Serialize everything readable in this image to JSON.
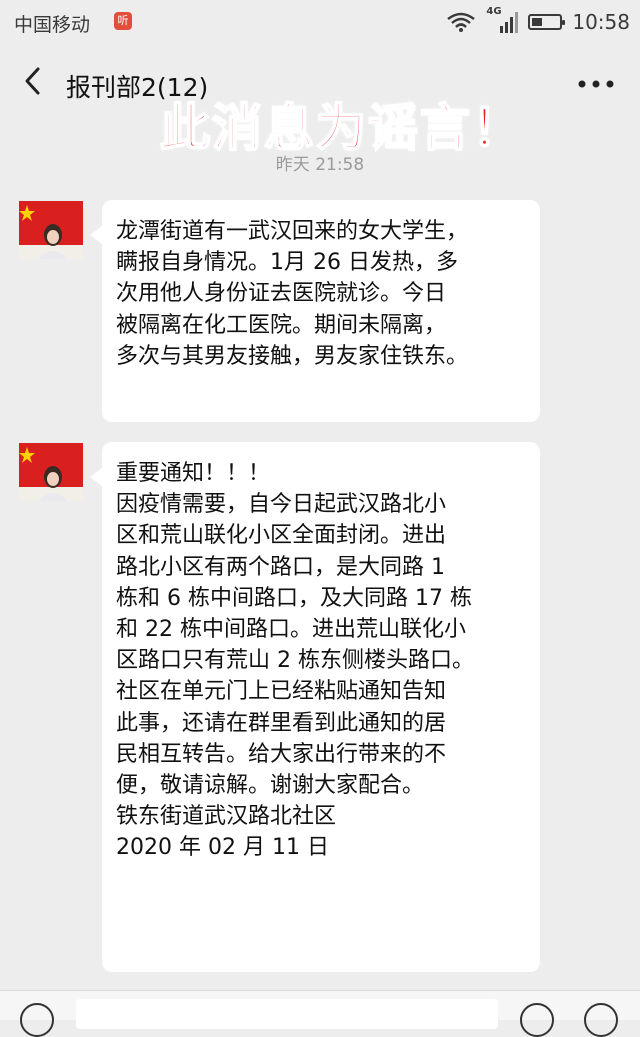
{
  "status_bar": {
    "carrier": "中国移动",
    "notification_badge": "听",
    "network_label": "4G",
    "time": "10:58"
  },
  "chat": {
    "title": "报刊部2(12)"
  },
  "overlay": {
    "rumor_label": "此消息为谣言！"
  },
  "timestamp": "昨天 21:58",
  "messages": [
    {
      "lines": [
        "龙潭街道有一武汉回来的女大学生，",
        "瞒报自身情况。1月 26 日发热，多",
        "次用他人身份证去医院就诊。今日",
        "被隔离在化工医院。期间未隔离，",
        "多次与其男友接触，男友家住铁东。"
      ]
    },
    {
      "lines": [
        "重要通知！！！",
        "因疫情需要，自今日起武汉路北小",
        "区和荒山联化小区全面封闭。进出",
        "路北小区有两个路口，是大同路 1",
        "栋和 6 栋中间路口，及大同路 17 栋",
        "和 22 栋中间路口。进出荒山联化小",
        "区路口只有荒山 2 栋东侧楼头路口。",
        "社区在单元门上已经粘贴通知告知",
        "此事，还请在群里看到此通知的居",
        "民相互转告。给大家出行带来的不",
        "便，敬请谅解。谢谢大家配合。",
        "铁东街道武汉路北社区",
        "2020 年 02 月 11 日"
      ]
    }
  ],
  "colors": {
    "background": "#ededed",
    "bubble": "#ffffff",
    "rumor_red": "#e8202a",
    "timestamp_gray": "#9a9a9a"
  },
  "icons": {
    "back": "back-arrow-icon",
    "more": "more-dots-icon",
    "wifi": "wifi-icon",
    "signal": "signal-bars-icon",
    "battery": "battery-icon"
  }
}
